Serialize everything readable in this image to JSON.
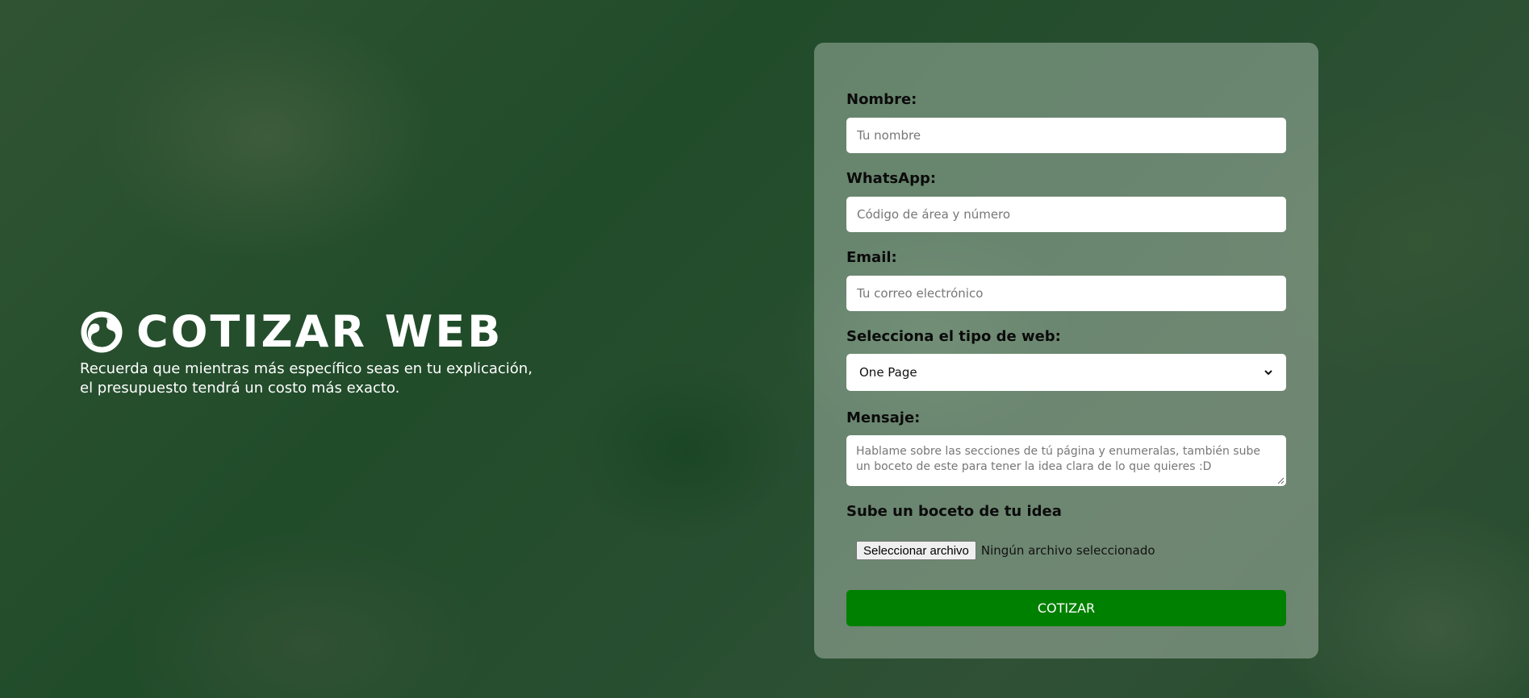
{
  "hero": {
    "title": "COTIZAR WEB",
    "subtitle": "Recuerda que mientras más específico seas en tu explicación, el presupuesto tendrá un costo más exacto."
  },
  "form": {
    "name_label": "Nombre:",
    "name_placeholder": "Tu nombre",
    "whatsapp_label": "WhatsApp:",
    "whatsapp_placeholder": "Código de área y número",
    "email_label": "Email:",
    "email_placeholder": "Tu correo electrónico",
    "web_type_label": "Selecciona el tipo de web:",
    "web_type_selected": "One Page",
    "message_label": "Mensaje:",
    "message_placeholder": "Hablame sobre las secciones de tú página y enumeralas, también sube un boceto de este para tener la idea clara de lo que quieres :D",
    "upload_label": "Sube un boceto de tu idea",
    "upload_button": "Seleccionar archivo",
    "upload_status": "Ningún archivo seleccionado",
    "submit_label": "COTIZAR"
  },
  "colors": {
    "overlay": "#003c19",
    "submit": "#008000",
    "text_light": "#ffffff"
  },
  "icons": {
    "title_icon": "globe-icon",
    "select_icon": "chevron-down-icon"
  }
}
